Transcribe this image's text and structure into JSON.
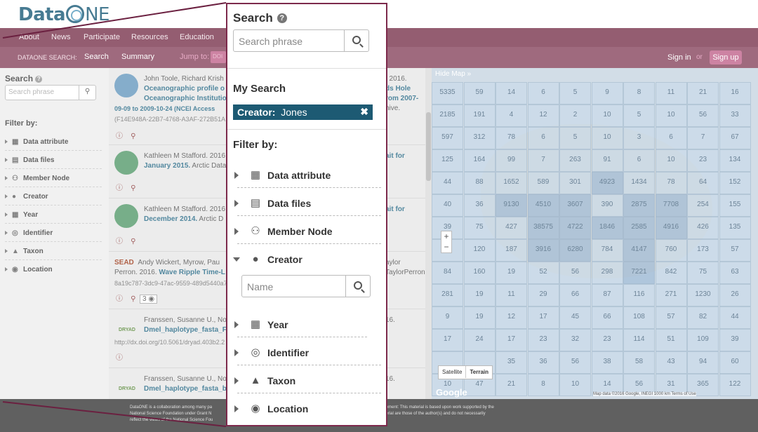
{
  "logo": {
    "data": "Data",
    "one": "NE"
  },
  "nav": {
    "about": "About",
    "news": "News",
    "participate": "Participate",
    "resources": "Resources",
    "education": "Education"
  },
  "subnav": {
    "search_label": "DATAONE SEARCH:",
    "search": "Search",
    "summary": "Summary",
    "jump": "Jump to:",
    "jump_value": "DOI",
    "signin": "Sign in",
    "or": "or",
    "signup": "Sign up"
  },
  "bg_sidebar": {
    "title": "Search",
    "placeholder": "Search phrase",
    "filter_title": "Filter by:",
    "items": [
      "Data attribute",
      "Data files",
      "Member Node",
      "Creator",
      "Year",
      "Identifier",
      "Taxon",
      "Location"
    ]
  },
  "results": [
    {
      "authors": "John Toole, Richard Krish",
      "title1": "Oceanographic profile o",
      "title2": "Oceanographic Institutio",
      "meta1": "09-09 to 2009-10-24 (NCEI Access",
      "meta2": "(F14E948A-22B7-4768-A3AF-272B51A",
      "right1": ". 2016.",
      "right2": "ds Hole",
      "right3": "rom 2007-",
      "right4": "hive."
    },
    {
      "authors": "Kathleen M Stafford. 2016",
      "title1": "January 2015.",
      "title_rest": " Arctic Data",
      "right1": "ait for"
    },
    {
      "authors": "Kathleen M Stafford. 2016",
      "title1": "December 2014.",
      "title_rest": " Arctic D",
      "right1": "ait for"
    },
    {
      "logo": "SEAD",
      "authors": "Andy Wickert, Myrow, Pau",
      "line2": "Perron. 2016. ",
      "title1": "Wave Ripple Time-L",
      "meta1": "8a19c787-3dc9-47ac-9559-489d5440a7",
      "count": "3",
      "right1": "aylor",
      "right2": "TaylorPerron-"
    },
    {
      "logo": "DRYAD",
      "authors": "Franssen, Susanne U., No",
      "title1": "Dmel_haplotype_fasta_F",
      "meta1": "http://dx.doi.org/10.5061/dryad.403b2.2",
      "right1": "16."
    },
    {
      "logo": "DRYAD",
      "authors": "Franssen, Susanne U., No",
      "title1": "Dmel_haplotype_fasta_b",
      "right1": "16."
    }
  ],
  "map": {
    "hide": "Hide Map",
    "rows": [
      [
        "5335",
        "59",
        "14",
        "6",
        "5",
        "9",
        "8",
        "11",
        "21",
        "16"
      ],
      [
        "2185",
        "191",
        "4",
        "12",
        "2",
        "10",
        "5",
        "10",
        "56",
        "33"
      ],
      [
        "597",
        "312",
        "78",
        "6",
        "5",
        "10",
        "3",
        "6",
        "7",
        "67"
      ],
      [
        "125",
        "164",
        "99",
        "7",
        "263",
        "91",
        "6",
        "10",
        "23",
        "134"
      ],
      [
        "44",
        "88",
        "1652",
        "589",
        "301",
        "4923",
        "1434",
        "78",
        "64",
        "152"
      ],
      [
        "40",
        "36",
        "9130",
        "4510",
        "3607",
        "390",
        "2875",
        "7708",
        "254",
        "155"
      ],
      [
        "39",
        "75",
        "427",
        "38575",
        "4722",
        "1846",
        "2585",
        "4916",
        "426",
        "135"
      ],
      [
        "34",
        "120",
        "187",
        "3916",
        "6280",
        "784",
        "4147",
        "760",
        "173",
        "57"
      ],
      [
        "84",
        "160",
        "19",
        "52",
        "56",
        "298",
        "7221",
        "842",
        "75",
        "63"
      ],
      [
        "281",
        "19",
        "11",
        "29",
        "66",
        "87",
        "116",
        "271",
        "1230",
        "26"
      ],
      [
        "9",
        "19",
        "12",
        "17",
        "45",
        "66",
        "108",
        "57",
        "82",
        "44"
      ],
      [
        "17",
        "24",
        "17",
        "23",
        "32",
        "23",
        "114",
        "51",
        "109",
        "39"
      ],
      [
        "",
        "",
        "35",
        "36",
        "56",
        "38",
        "58",
        "43",
        "94",
        "60"
      ],
      [
        "10",
        "47",
        "21",
        "8",
        "10",
        "14",
        "56",
        "31",
        "365",
        "122"
      ]
    ],
    "satellite": "Satellite",
    "terrain": "Terrain",
    "google": "Google",
    "attribution": "Map data ©2016 Google, INEGI  1000 km          Terms of Use"
  },
  "footer": {
    "line1": "DataONE is a collaboration among many pa                                                                   NSF) under a Cooperative Agreement. Acknowledgement: This material is based upon work supported by the",
    "line2": "National Science Foundation under Grant N                                                                   clusions or recommendations expressed in this material are those of the author(s) and do not necessarily",
    "line3": "reflect the views of the National Science Fou"
  },
  "panel": {
    "title": "Search",
    "help": "?",
    "placeholder": "Search phrase",
    "my_search_title": "My Search",
    "tag_key": "Creator:",
    "tag_value": "Jones",
    "tag_remove": "✖",
    "filter_title": "Filter by:",
    "filters": [
      "Data attribute",
      "Data files",
      "Member Node",
      "Creator",
      "Year",
      "Identifier",
      "Taxon",
      "Location"
    ],
    "name_placeholder": "Name"
  },
  "colors": {
    "nav": "#7d3a52",
    "subnav": "#8a4a62",
    "accent": "#c2688f",
    "tag": "#1d5a73",
    "panel_border": "#7d2a4c",
    "link": "#2d6e8a"
  }
}
